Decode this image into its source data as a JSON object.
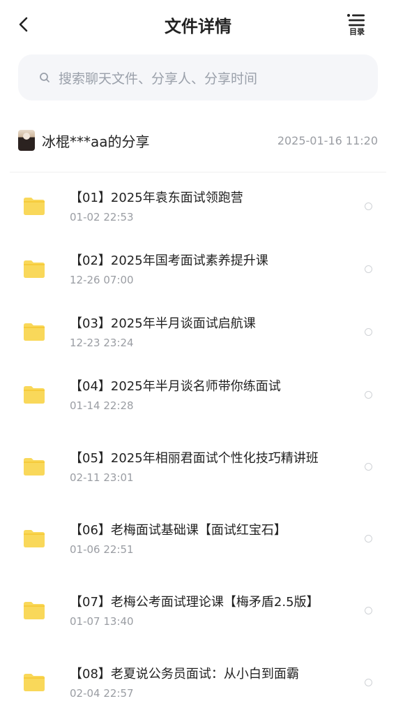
{
  "header": {
    "title": "文件详情",
    "toc_label": "目录",
    "back_icon": "chevron-left-icon",
    "toc_icon": "list-icon"
  },
  "search": {
    "placeholder": "搜索聊天文件、分享人、分享时间",
    "icon": "search-icon"
  },
  "share": {
    "owner": "冰棍***aa的分享",
    "time": "2025-01-16  11:20"
  },
  "colors": {
    "folder": "#f9d85a",
    "folder_tab": "#f6cb3b",
    "muted": "#9a9da3"
  },
  "files": [
    {
      "name": "【01】2025年袁东面试领跑营",
      "date": "01-02  22:53"
    },
    {
      "name": "【02】2025年国考面试素养提升课",
      "date": "12-26  07:00"
    },
    {
      "name": "【03】2025年半月谈面试启航课",
      "date": "12-23  23:24"
    },
    {
      "name": "【04】2025年半月谈名师带你练面试",
      "date": "01-14  22:28"
    },
    {
      "name": "【05】2025年相丽君面试个性化技巧精讲班",
      "date": "02-11  23:01"
    },
    {
      "name": "【06】老梅面试基础课【面试红宝石】",
      "date": "01-06  22:51"
    },
    {
      "name": "【07】老梅公考面试理论课【梅矛盾2.5版】",
      "date": "01-07  13:40"
    },
    {
      "name": "【08】老夏说公务员面试：从小白到面霸",
      "date": "02-04  22:57"
    }
  ]
}
